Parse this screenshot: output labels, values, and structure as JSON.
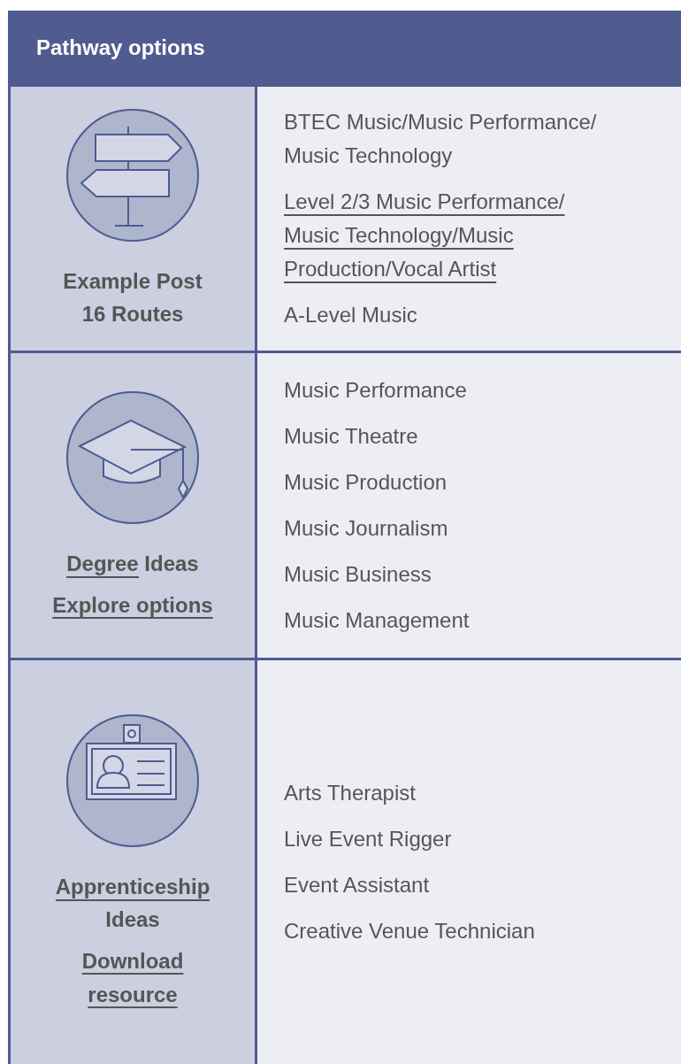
{
  "header": {
    "title": "Pathway options"
  },
  "rows": [
    {
      "kind": "signpost",
      "title": [
        {
          "text": "Example Post 16 Routes",
          "link": false
        }
      ],
      "action": null,
      "items": [
        {
          "text": "BTEC Music/Music Performance/ Music Technology",
          "link": false
        },
        {
          "text": "Level 2/3 Music Performance/ Music Technology/Music Production/Vocal Artist",
          "link": true
        },
        {
          "text": "A-Level Music",
          "link": false
        }
      ]
    },
    {
      "kind": "cap",
      "title": [
        {
          "text": "Degree",
          "link": true
        },
        {
          "text": "Ideas",
          "link": false
        }
      ],
      "action": {
        "text": "Explore options"
      },
      "items": [
        {
          "text": "Music Performance",
          "link": false
        },
        {
          "text": "Music Theatre",
          "link": false
        },
        {
          "text": "Music Production",
          "link": false
        },
        {
          "text": "Music Journalism",
          "link": false
        },
        {
          "text": "Music Business",
          "link": false
        },
        {
          "text": "Music Management",
          "link": false
        }
      ]
    },
    {
      "kind": "badge",
      "title": [
        {
          "text": "Apprenticeship",
          "link": true
        },
        {
          "text": "Ideas",
          "link": false
        }
      ],
      "action": {
        "text": "Download resource"
      },
      "items": [
        {
          "text": "Arts Therapist",
          "link": false
        },
        {
          "text": "Live Event Rigger",
          "link": false
        },
        {
          "text": "Event Assistant",
          "link": false
        },
        {
          "text": "Creative Venue Technician",
          "link": false
        }
      ]
    }
  ]
}
